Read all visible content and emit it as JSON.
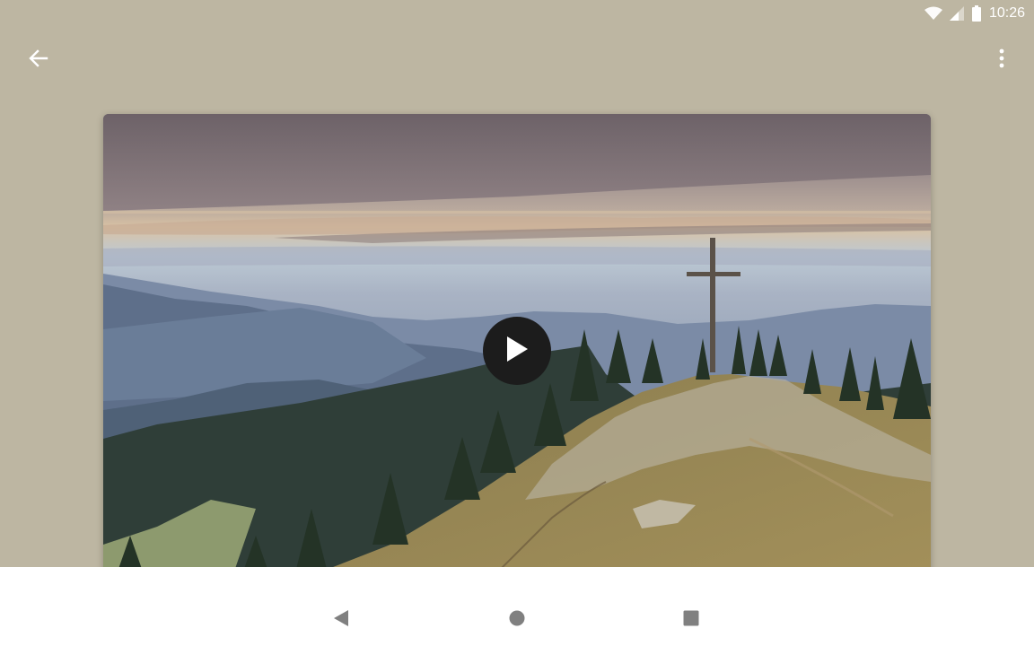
{
  "status_bar": {
    "time": "10:26",
    "icons": [
      "wifi-icon",
      "cell-signal-icon",
      "battery-icon"
    ]
  },
  "top_bar": {
    "icons": [
      "back-arrow-icon",
      "more-vert-icon"
    ]
  },
  "media": {
    "type": "video",
    "play_icon": "play-icon"
  },
  "navigation_bar": {
    "icons": [
      "nav-back-icon",
      "nav-home-icon",
      "nav-recents-icon"
    ]
  },
  "colors": {
    "background": "#bdb6a2",
    "icon_white": "#ffffff",
    "play_button_bg": "#1c1c1c",
    "nav_bar_bg": "#ffffff",
    "nav_icon": "#808080"
  }
}
